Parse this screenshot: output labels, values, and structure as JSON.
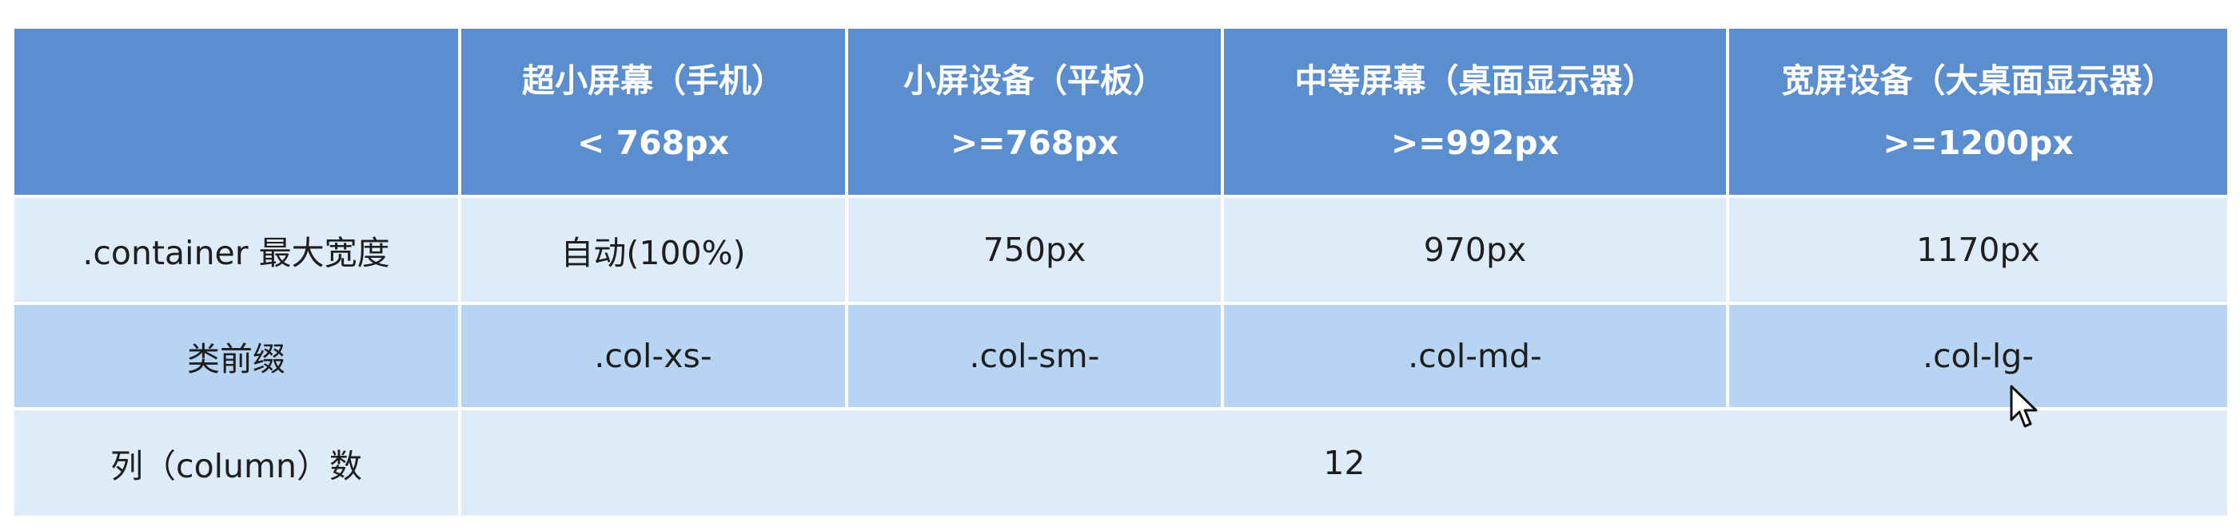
{
  "table": {
    "header": {
      "corner": "",
      "columns": [
        {
          "title": "超小屏幕（手机）",
          "sub": "< 768px"
        },
        {
          "title": "小屏设备（平板）",
          "sub": ">=768px"
        },
        {
          "title": "中等屏幕（桌面显示器）",
          "sub": ">=992px"
        },
        {
          "title": "宽屏设备（大桌面显示器）",
          "sub": ">=1200px"
        }
      ]
    },
    "rows": [
      {
        "label": ".container 最大宽度",
        "cells": [
          "自动(100%)",
          "750px",
          "970px",
          "1170px"
        ]
      },
      {
        "label": "类前缀",
        "cells": [
          ".col-xs-",
          ".col-sm-",
          ".col-md-",
          ".col-lg-"
        ]
      },
      {
        "label": "列（column）数",
        "merged": "12"
      }
    ]
  },
  "colors": {
    "header_bg": "#5b8ecf",
    "row_light": "#deebf8",
    "row_mid": "#b7d4f2"
  },
  "cursor_icon": "mouse-pointer-icon"
}
